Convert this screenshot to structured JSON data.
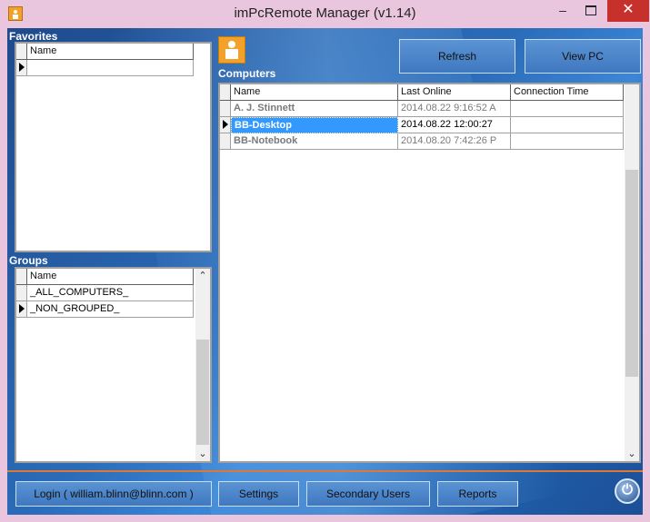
{
  "window": {
    "title": "imPcRemote Manager (v1.14)",
    "min_glyph": "–",
    "close_glyph": "✕"
  },
  "favorites": {
    "label": "Favorites",
    "columns": [
      "Name"
    ],
    "rows": [
      ""
    ]
  },
  "groups": {
    "label": "Groups",
    "columns": [
      "Name"
    ],
    "rows": [
      "_ALL_COMPUTERS_",
      "_NON_GROUPED_"
    ]
  },
  "computers": {
    "label": "Computers",
    "columns": [
      "Name",
      "Last Online",
      "Connection Time"
    ],
    "rows": [
      {
        "name": "A. J. Stinnett",
        "last_online": "2014.08.22 9:16:52 A",
        "connection_time": ""
      },
      {
        "name": "BB-Desktop",
        "last_online": "2014.08.22 12:00:27",
        "connection_time": ""
      },
      {
        "name": "BB-Notebook",
        "last_online": "2014.08.20 7:42:26 P",
        "connection_time": ""
      }
    ]
  },
  "toolbar": {
    "refresh": "Refresh",
    "view_pc": "View PC"
  },
  "bottom": {
    "login": "Login ( william.blinn@blinn.com )",
    "settings": "Settings",
    "secondary_users": "Secondary Users",
    "reports": "Reports"
  },
  "colors": {
    "accent": "#3399ff",
    "separator": "#e07832",
    "close": "#c7312b"
  },
  "icons": [
    "app-icon",
    "computer-user-icon",
    "power-icon",
    "row-pointer-icon",
    "chevron-up-icon",
    "chevron-down-icon"
  ]
}
